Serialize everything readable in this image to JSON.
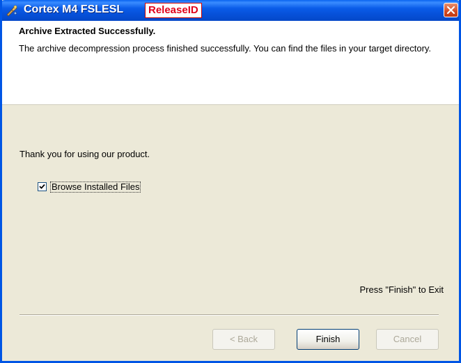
{
  "window": {
    "title": "Cortex M4 FSLESL",
    "badge": "ReleaseID",
    "colors": {
      "titlebar": "#0A5CE8",
      "badge_text": "#e0001a",
      "face": "#ECE9D8",
      "close": "#D24A22"
    }
  },
  "header": {
    "title": "Archive Extracted Successfully.",
    "description": "The archive decompression process finished successfully. You can find the files in your target directory."
  },
  "body": {
    "thanks": "Thank you for using our product.",
    "browse_checkbox": {
      "label": "Browse Installed Files",
      "checked": true
    },
    "press_finish": "Press \"Finish\" to Exit"
  },
  "buttons": {
    "back": "< Back",
    "finish": "Finish",
    "cancel": "Cancel"
  },
  "icons": {
    "app": "installer-app-icon",
    "close": "close-icon",
    "check": "checkmark-icon"
  }
}
